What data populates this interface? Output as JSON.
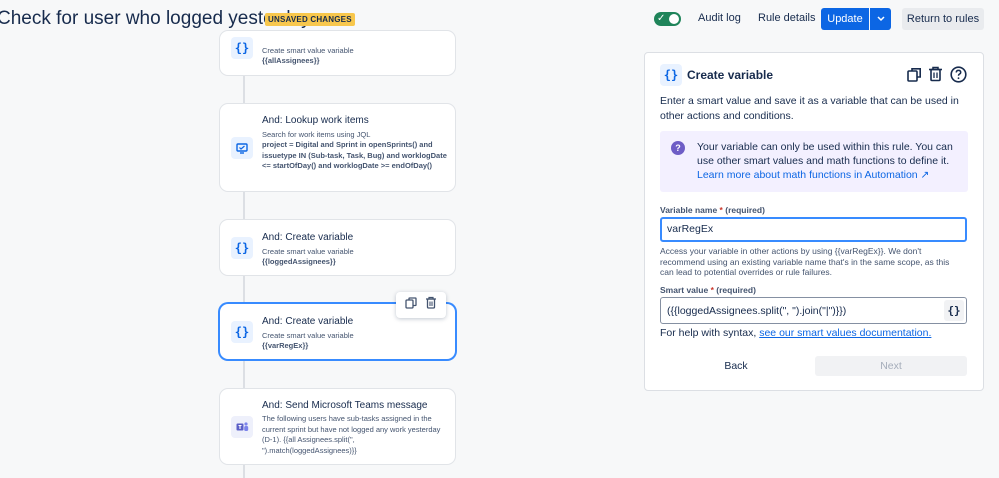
{
  "header": {
    "title": "Check for user who logged yesterday",
    "badge": "UNSAVED CHANGES",
    "audit_log": "Audit log",
    "rule_details": "Rule details",
    "update_label": "Update",
    "return_label": "Return to rules",
    "rule_enabled": true
  },
  "flow": {
    "cards": [
      {
        "title": "",
        "subtitle": "Create smart value variable",
        "detail": "{{allAssignees}}",
        "icon": "braces-icon"
      },
      {
        "title": "And: Lookup work items",
        "subtitle": "Search for work items using JQL",
        "detail": "project = Digital and Sprint in openSprints() and issuetype IN (Sub-task, Task, Bug) and worklogDate <= startOfDay() and worklogDate >= endOfDay()",
        "icon": "monitor-icon"
      },
      {
        "title": "And: Create variable",
        "subtitle": "Create smart value variable",
        "detail": "{{loggedAssignees}}",
        "icon": "braces-icon"
      },
      {
        "title": "And: Create variable",
        "subtitle": "Create smart value variable",
        "detail": "{{varRegEx}}",
        "icon": "braces-icon",
        "selected": true
      },
      {
        "title": "And: Send Microsoft Teams message",
        "body": "The following users have sub-tasks assigned in the current sprint but have not logged any work yesterday (D-1). {{all Assignees.split(\", \").match(loggedAssignees)}}",
        "icon": "teams-icon"
      }
    ]
  },
  "panel": {
    "title": "Create variable",
    "description": "Enter a smart value and save it as a variable that can be used in other actions and conditions.",
    "info_text": "Your variable can only be used within this rule. You can use other smart values and math functions to define it.",
    "info_link": "Learn more about math functions in Automation ↗",
    "variable_name_label": "Variable name",
    "required_mark": "*",
    "required_text": "(required)",
    "variable_name_value": "varRegEx",
    "helper_text": "Access your variable in other actions by using {{varRegEx}}. We don't recommend using an existing variable name that's in the same scope, as this can lead to potential overrides or rule failures.",
    "smart_value_label": "Smart value",
    "smart_value": "({{loggedAssignees.split(\", \").join(\"|\")}})",
    "syntax_help_prefix": "For help with syntax,",
    "syntax_help_link": "see our smart values documentation.",
    "back_label": "Back",
    "next_label": "Next"
  },
  "colors": {
    "primary": "#0c66e4",
    "badge": "#f8c74c",
    "toggle_on": "#1f845a",
    "info_bg": "#f3f0ff",
    "selected_border": "#388bff"
  }
}
